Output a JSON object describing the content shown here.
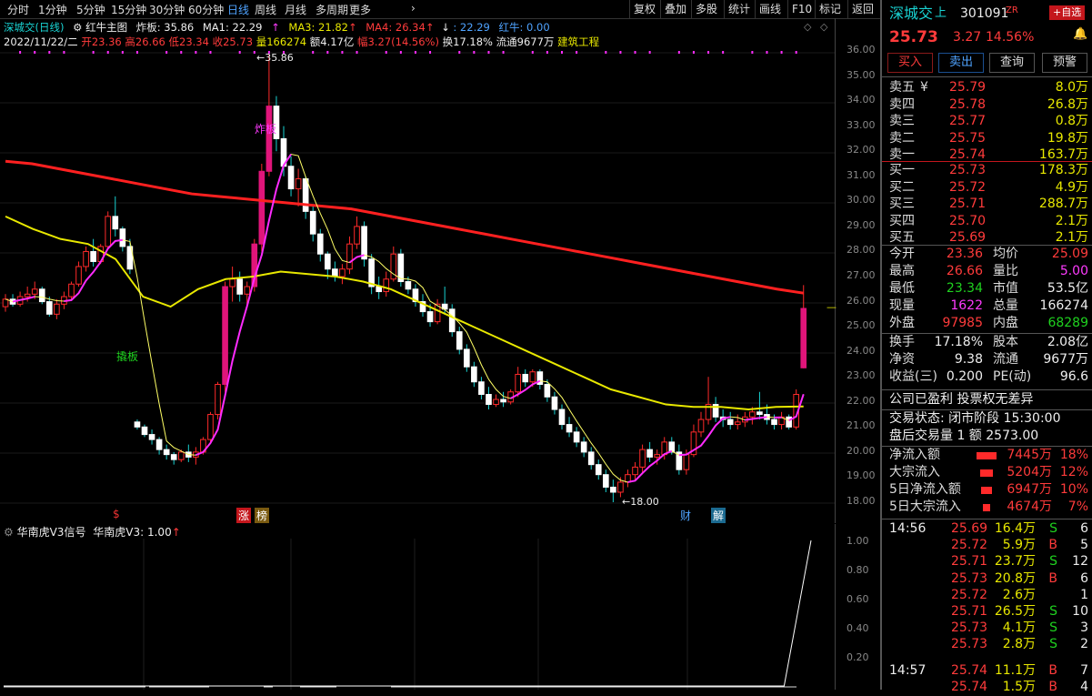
{
  "toolbar": {
    "periods": [
      "分时",
      "1分钟",
      "5分钟",
      "15分钟",
      "30分钟",
      "60分钟",
      "日线",
      "周线",
      "月线",
      "多周期",
      "更多"
    ],
    "active": "日线",
    "right_buttons": [
      "复权",
      "叠加",
      "多股",
      "统计",
      "画线",
      "F10",
      "标记",
      "返回"
    ]
  },
  "info1": {
    "stock": "深城交(日线)",
    "indicator": "红牛主图",
    "zhaban": "炸板: 35.86",
    "ma1": "MA1: 22.29",
    "ma3": "MA3: 21.82",
    "ma4": "MA4: 26.34",
    "ma5": ": 22.29",
    "hongniu": "红牛: 0.00"
  },
  "info2": {
    "date": "2022/11/22/二",
    "open": "开23.36",
    "high": "高26.66",
    "low": "低23.34",
    "close": "收25.73",
    "vol": "量166274",
    "amount": "额4.17亿",
    "amp": "幅3.27(14.56%)",
    "turnover": "换17.18%",
    "float": "流通9677万",
    "sector": "建筑工程"
  },
  "chart_labels": {
    "high_mark": "35.86",
    "low_mark": "18.00",
    "zhaban_text": "炸板",
    "qiaoban_text": "撬板",
    "bottom_tags": [
      "$",
      "涨",
      "榜",
      "财",
      "解"
    ]
  },
  "yaxis_ticks": [
    "36.00",
    "35.00",
    "34.00",
    "33.00",
    "32.00",
    "31.00",
    "30.00",
    "29.00",
    "28.00",
    "27.00",
    "26.00",
    "25.00",
    "24.00",
    "23.00",
    "22.00",
    "21.00",
    "20.00",
    "19.00",
    "18.00"
  ],
  "sub": {
    "title": "华南虎V3信号",
    "value": "华南虎V3: 1.00",
    "ticks": [
      "1.00",
      "0.80",
      "0.60",
      "0.40",
      "0.20"
    ]
  },
  "chart_data": {
    "type": "candlestick",
    "ylim": [
      17.5,
      36.5
    ],
    "candles": [
      [
        25.8,
        26.3,
        25.6,
        26.1
      ],
      [
        26.1,
        26.3,
        25.8,
        25.9
      ],
      [
        25.9,
        26.4,
        25.8,
        26.2
      ],
      [
        26.2,
        26.6,
        26.0,
        26.3
      ],
      [
        26.3,
        26.8,
        26.1,
        26.5
      ],
      [
        26.5,
        26.6,
        25.9,
        26.0
      ],
      [
        26.0,
        26.2,
        25.4,
        25.5
      ],
      [
        25.5,
        26.1,
        25.3,
        25.9
      ],
      [
        25.9,
        26.4,
        25.7,
        26.2
      ],
      [
        26.2,
        26.8,
        26.1,
        26.7
      ],
      [
        26.7,
        27.6,
        26.6,
        27.4
      ],
      [
        27.4,
        28.2,
        27.2,
        28.0
      ],
      [
        28.0,
        28.5,
        27.4,
        27.6
      ],
      [
        27.6,
        28.3,
        27.5,
        28.2
      ],
      [
        28.2,
        29.6,
        28.1,
        29.4
      ],
      [
        29.4,
        30.2,
        28.6,
        28.9
      ],
      [
        28.9,
        29.0,
        28.0,
        28.2
      ],
      [
        28.2,
        28.5,
        27.1,
        27.3
      ],
      [
        21.2,
        21.3,
        20.9,
        21.0
      ],
      [
        21.0,
        21.1,
        20.6,
        20.7
      ],
      [
        20.7,
        20.9,
        20.3,
        20.5
      ],
      [
        20.5,
        20.6,
        19.9,
        20.1
      ],
      [
        20.1,
        20.3,
        19.7,
        19.9
      ],
      [
        19.9,
        20.0,
        19.5,
        19.7
      ],
      [
        19.7,
        20.1,
        19.6,
        20.0
      ],
      [
        20.0,
        20.3,
        19.6,
        19.8
      ],
      [
        19.8,
        20.2,
        19.5,
        20.0
      ],
      [
        20.0,
        20.6,
        19.9,
        20.5
      ],
      [
        20.5,
        21.6,
        20.4,
        21.5
      ],
      [
        21.5,
        22.8,
        21.3,
        22.7
      ],
      [
        22.7,
        26.8,
        22.4,
        26.6
      ],
      [
        26.6,
        27.4,
        26.0,
        26.9
      ],
      [
        26.9,
        27.2,
        26.0,
        26.3
      ],
      [
        26.3,
        26.8,
        25.8,
        26.6
      ],
      [
        26.6,
        28.5,
        26.4,
        28.3
      ],
      [
        28.3,
        31.5,
        28.0,
        31.2
      ],
      [
        31.2,
        35.86,
        31.0,
        33.8
      ],
      [
        33.8,
        34.2,
        32.0,
        32.5
      ],
      [
        32.5,
        33.0,
        31.0,
        31.4
      ],
      [
        31.4,
        31.8,
        30.2,
        30.5
      ],
      [
        30.5,
        31.3,
        29.8,
        30.9
      ],
      [
        30.9,
        31.0,
        29.3,
        29.6
      ],
      [
        29.6,
        29.8,
        28.4,
        28.7
      ],
      [
        28.7,
        28.9,
        27.6,
        27.9
      ],
      [
        27.9,
        28.0,
        26.9,
        27.3
      ],
      [
        27.3,
        27.6,
        26.8,
        27.0
      ],
      [
        27.0,
        27.5,
        26.7,
        27.3
      ],
      [
        27.3,
        28.6,
        27.1,
        28.3
      ],
      [
        28.3,
        29.4,
        28.1,
        29.0
      ],
      [
        29.0,
        29.2,
        27.4,
        27.7
      ],
      [
        27.7,
        27.9,
        26.3,
        26.6
      ],
      [
        26.6,
        27.0,
        26.1,
        26.4
      ],
      [
        26.4,
        27.2,
        26.2,
        26.9
      ],
      [
        26.9,
        28.2,
        26.8,
        27.9
      ],
      [
        27.9,
        28.1,
        26.6,
        26.8
      ],
      [
        26.8,
        27.0,
        26.3,
        26.5
      ],
      [
        26.5,
        26.7,
        25.8,
        26.0
      ],
      [
        26.0,
        26.3,
        25.4,
        25.6
      ],
      [
        25.6,
        25.9,
        25.0,
        25.2
      ],
      [
        25.2,
        26.1,
        25.1,
        25.9
      ],
      [
        25.9,
        26.6,
        25.5,
        25.7
      ],
      [
        25.7,
        25.9,
        24.6,
        24.8
      ],
      [
        24.8,
        25.0,
        23.9,
        24.1
      ],
      [
        24.1,
        24.3,
        23.2,
        23.4
      ],
      [
        23.4,
        23.6,
        22.6,
        22.8
      ],
      [
        22.8,
        23.0,
        22.1,
        22.3
      ],
      [
        22.3,
        22.6,
        21.7,
        21.9
      ],
      [
        21.9,
        22.3,
        21.8,
        22.1
      ],
      [
        22.1,
        22.4,
        21.8,
        22.0
      ],
      [
        22.0,
        22.5,
        21.9,
        22.4
      ],
      [
        22.4,
        23.4,
        22.2,
        23.1
      ],
      [
        23.1,
        23.3,
        22.6,
        22.8
      ],
      [
        22.8,
        23.3,
        22.6,
        23.2
      ],
      [
        23.2,
        23.3,
        22.5,
        22.7
      ],
      [
        22.7,
        22.9,
        22.0,
        22.2
      ],
      [
        22.2,
        22.4,
        21.5,
        21.7
      ],
      [
        21.7,
        21.9,
        20.9,
        21.1
      ],
      [
        21.1,
        21.4,
        20.6,
        20.8
      ],
      [
        20.8,
        21.0,
        20.2,
        20.4
      ],
      [
        20.4,
        20.6,
        19.8,
        20.0
      ],
      [
        20.0,
        20.2,
        19.3,
        19.5
      ],
      [
        19.5,
        19.7,
        18.9,
        19.1
      ],
      [
        19.1,
        19.3,
        18.4,
        18.6
      ],
      [
        18.6,
        18.9,
        18.0,
        18.4
      ],
      [
        18.4,
        19.0,
        18.2,
        18.8
      ],
      [
        18.8,
        19.3,
        18.6,
        19.1
      ],
      [
        19.1,
        19.6,
        18.9,
        19.4
      ],
      [
        19.4,
        20.3,
        19.2,
        20.1
      ],
      [
        20.1,
        20.4,
        19.6,
        19.8
      ],
      [
        19.8,
        20.1,
        19.5,
        19.9
      ],
      [
        19.9,
        20.6,
        19.7,
        20.4
      ],
      [
        20.4,
        20.6,
        19.9,
        20.0
      ],
      [
        20.0,
        20.3,
        19.1,
        19.3
      ],
      [
        19.3,
        20.1,
        19.1,
        19.9
      ],
      [
        19.9,
        21.1,
        19.8,
        20.8
      ],
      [
        20.8,
        21.6,
        20.6,
        21.3
      ],
      [
        21.3,
        23.0,
        21.1,
        21.9
      ],
      [
        21.9,
        22.2,
        21.2,
        21.4
      ],
      [
        21.4,
        21.7,
        21.0,
        21.3
      ],
      [
        21.3,
        21.6,
        20.9,
        21.1
      ],
      [
        21.1,
        21.5,
        20.9,
        21.2
      ],
      [
        21.2,
        21.6,
        21.0,
        21.4
      ],
      [
        21.4,
        21.8,
        21.1,
        21.6
      ],
      [
        21.6,
        22.4,
        21.3,
        21.5
      ],
      [
        21.5,
        21.9,
        21.1,
        21.3
      ],
      [
        21.3,
        21.5,
        20.9,
        21.1
      ],
      [
        21.1,
        21.6,
        20.9,
        21.4
      ],
      [
        21.4,
        21.5,
        20.9,
        21.0
      ],
      [
        21.0,
        22.5,
        20.9,
        22.3
      ],
      [
        23.36,
        26.66,
        23.34,
        25.73
      ]
    ],
    "ma_red": [
      31.6,
      31.5,
      31.3,
      31.1,
      30.9,
      30.7,
      30.5,
      30.3,
      30.2,
      30.1,
      30.0,
      29.9,
      29.8,
      29.7,
      29.5,
      29.3,
      29.1,
      28.9,
      28.7,
      28.5,
      28.3,
      28.1,
      27.9,
      27.7,
      27.5,
      27.3,
      27.1,
      26.9,
      26.7,
      26.5,
      26.34
    ],
    "ma_yellow": [
      29.4,
      28.9,
      28.5,
      28.3,
      27.7,
      26.2,
      25.8,
      26.5,
      26.9,
      27.0,
      27.2,
      27.1,
      27.0,
      26.8,
      26.5,
      26.0,
      25.5,
      25.0,
      24.5,
      24.0,
      23.5,
      23.0,
      22.5,
      22.2,
      21.9,
      21.8,
      21.8,
      21.7,
      21.8,
      21.82
    ],
    "signal": [
      0,
      0,
      0,
      0,
      0,
      0,
      0,
      0,
      0,
      0,
      0,
      0,
      0,
      0,
      0,
      0,
      0,
      0,
      0,
      0,
      0,
      0,
      0,
      0,
      0,
      0,
      0,
      0,
      0,
      0,
      1.0
    ]
  },
  "quote": {
    "name": "深城交",
    "suffix": "上",
    "code": "301091",
    "zr": "ZR",
    "add_btn": "+自选",
    "price": "25.73",
    "change": "3.27",
    "pct": "14.56%",
    "buttons": [
      "买入",
      "卖出",
      "查询",
      "预警"
    ]
  },
  "asks": [
    {
      "label": "卖五",
      "price": "25.79",
      "vol": "8.0万",
      "mark": "¥"
    },
    {
      "label": "卖四",
      "price": "25.78",
      "vol": "26.8万",
      "mark": ""
    },
    {
      "label": "卖三",
      "price": "25.77",
      "vol": "0.8万",
      "mark": ""
    },
    {
      "label": "卖二",
      "price": "25.75",
      "vol": "19.8万",
      "mark": ""
    },
    {
      "label": "卖一",
      "price": "25.74",
      "vol": "163.7万",
      "mark": ""
    }
  ],
  "bids": [
    {
      "label": "买一",
      "price": "25.73",
      "vol": "178.3万"
    },
    {
      "label": "买二",
      "price": "25.72",
      "vol": "4.9万"
    },
    {
      "label": "买三",
      "price": "25.71",
      "vol": "288.7万"
    },
    {
      "label": "买四",
      "price": "25.70",
      "vol": "2.1万"
    },
    {
      "label": "买五",
      "price": "25.69",
      "vol": "2.1万"
    }
  ],
  "stats": [
    {
      "l": "今开",
      "v": "23.36",
      "l2": "均价",
      "v2": "25.09"
    },
    {
      "l": "最高",
      "v": "26.66",
      "l2": "量比",
      "v2": "5.00"
    },
    {
      "l": "最低",
      "v": "23.34",
      "l2": "市值",
      "v2": "53.5亿"
    },
    {
      "l": "现量",
      "v": "1622",
      "l2": "总量",
      "v2": "166274"
    },
    {
      "l": "外盘",
      "v": "97985",
      "l2": "内盘",
      "v2": "68289"
    }
  ],
  "stats2": [
    {
      "l": "换手",
      "v": "17.18%",
      "l2": "股本",
      "v2": "2.08亿"
    },
    {
      "l": "净资",
      "v": "9.38",
      "l2": "流通",
      "v2": "9677万"
    },
    {
      "l": "收益(三)",
      "v": "0.200",
      "l2": "PE(动)",
      "v2": "96.6"
    }
  ],
  "notes": {
    "profit": "公司已盈利 投票权无差异",
    "status": "交易状态: 闭市阶段 15:30:00",
    "after": "盘后交易量 1 额 2573.00"
  },
  "flows": [
    {
      "label": "净流入额",
      "value": "7445万",
      "pct": "18%",
      "bar": 0.18
    },
    {
      "label": "大宗流入",
      "value": "5204万",
      "pct": "12%",
      "bar": 0.12
    },
    {
      "label": "5日净流入额",
      "value": "6947万",
      "pct": "10%",
      "bar": 0.1
    },
    {
      "label": "5日大宗流入",
      "value": "4674万",
      "pct": "7%",
      "bar": 0.07
    }
  ],
  "ticks": [
    {
      "time": "14:56",
      "price": "25.69",
      "vol": "16.4万",
      "side": "S",
      "n": "6"
    },
    {
      "time": "",
      "price": "25.72",
      "vol": "5.9万",
      "side": "B",
      "n": "5"
    },
    {
      "time": "",
      "price": "25.71",
      "vol": "23.7万",
      "side": "S",
      "n": "12"
    },
    {
      "time": "",
      "price": "25.73",
      "vol": "20.8万",
      "side": "B",
      "n": "6"
    },
    {
      "time": "",
      "price": "25.72",
      "vol": "2.6万",
      "side": "",
      "n": "1"
    },
    {
      "time": "",
      "price": "25.71",
      "vol": "26.5万",
      "side": "S",
      "n": "10"
    },
    {
      "time": "",
      "price": "25.73",
      "vol": "4.1万",
      "side": "S",
      "n": "3"
    },
    {
      "time": "",
      "price": "25.73",
      "vol": "2.8万",
      "side": "S",
      "n": "2"
    },
    {
      "time": "14:57",
      "price": "25.74",
      "vol": "11.1万",
      "side": "B",
      "n": "7"
    },
    {
      "time": "",
      "price": "25.74",
      "vol": "1.5万",
      "side": "B",
      "n": "4"
    }
  ]
}
